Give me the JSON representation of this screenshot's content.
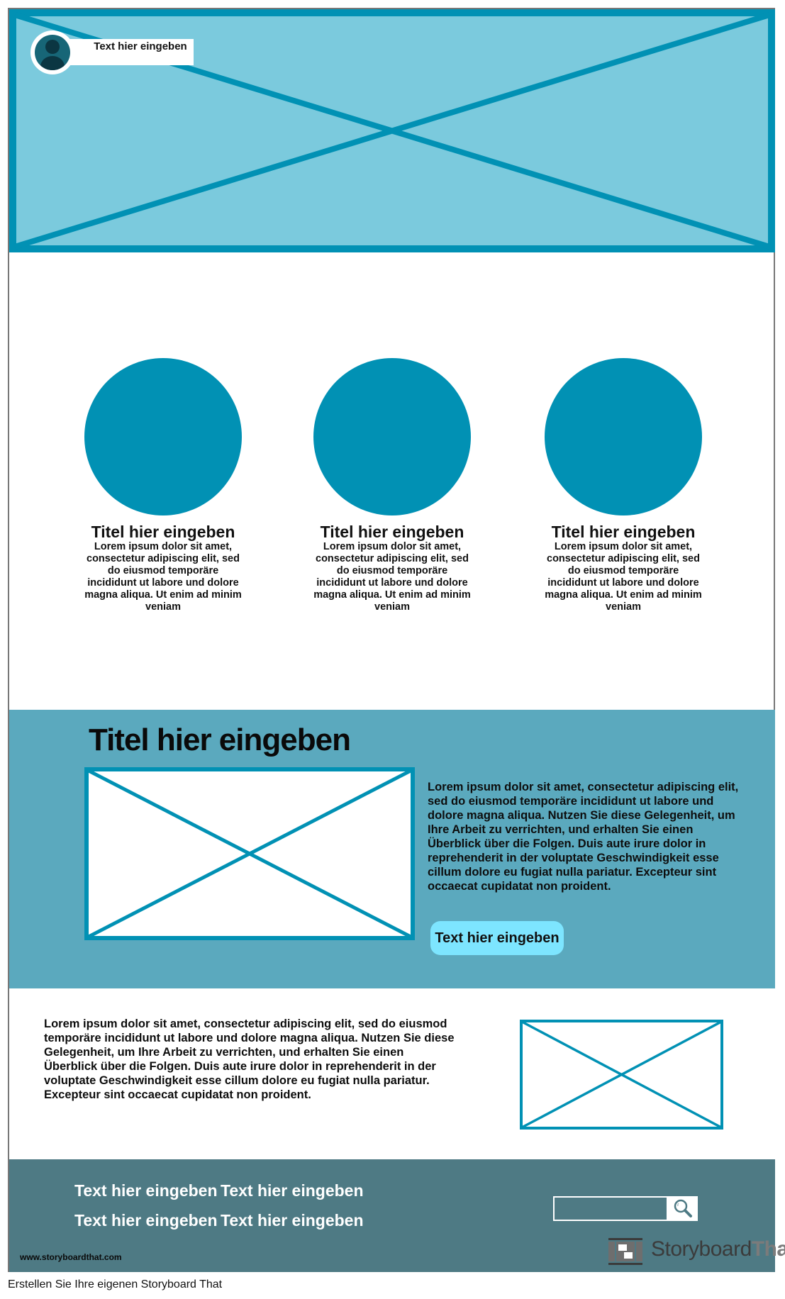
{
  "hero": {
    "profile_label": "Text hier eingeben",
    "avatar_icon": "user-avatar-icon",
    "background_color": "#7BCADD",
    "accent_color": "#0191B4"
  },
  "features": [
    {
      "title": "Titel hier eingeben",
      "text": "Lorem ipsum dolor sit amet, consectetur adipiscing elit, sed do eiusmod temporäre incididunt ut labore und dolore magna aliqua. Ut enim ad minim veniam"
    },
    {
      "title": "Titel hier eingeben",
      "text": "Lorem ipsum dolor sit amet, consectetur adipiscing elit, sed do eiusmod temporäre incididunt ut labore und dolore magna aliqua. Ut enim ad minim veniam"
    },
    {
      "title": "Titel hier eingeben",
      "text": "Lorem ipsum dolor sit amet, consectetur adipiscing elit, sed do eiusmod temporäre incididunt ut labore und dolore magna aliqua. Ut enim ad minim veniam"
    }
  ],
  "highlight": {
    "title": "Titel hier eingeben",
    "text": "Lorem ipsum dolor sit amet, consectetur adipiscing elit, sed do eiusmod temporäre incididunt ut labore und dolore magna aliqua. Nutzen Sie diese Gelegenheit, um Ihre Arbeit zu verrichten, und erhalten Sie einen Überblick über die Folgen. Duis aute irure dolor in reprehenderit in der voluptate Geschwindigkeit esse cillum dolore eu fugiat nulla pariatur. Excepteur sint occaecat cupidatat non proident.",
    "button_label": "Text hier eingeben",
    "background_color": "#5BA9BE",
    "button_color": "#7DE5FF"
  },
  "details": {
    "text": "Lorem ipsum dolor sit amet, consectetur adipiscing elit, sed do eiusmod temporäre incididunt ut labore und dolore magna aliqua. Nutzen Sie diese Gelegenheit, um Ihre Arbeit zu verrichten, und erhalten Sie einen Überblick über die Folgen. Duis aute irure dolor in reprehenderit in der voluptate Geschwindigkeit esse cillum dolore eu fugiat nulla pariatur. Excepteur sint occaecat cupidatat non proident."
  },
  "footer": {
    "links": [
      "Text hier eingeben",
      "Text hier eingeben",
      "Text hier eingeben",
      "Text hier eingeben"
    ],
    "url": "www.storyboardthat.com",
    "search_placeholder": "",
    "search_icon": "magnifier-icon",
    "logo_word1": "Storyboard",
    "logo_word2": "That",
    "background_color": "#4E7A84"
  },
  "caption": "Erstellen Sie Ihre eigenen Storyboard That"
}
